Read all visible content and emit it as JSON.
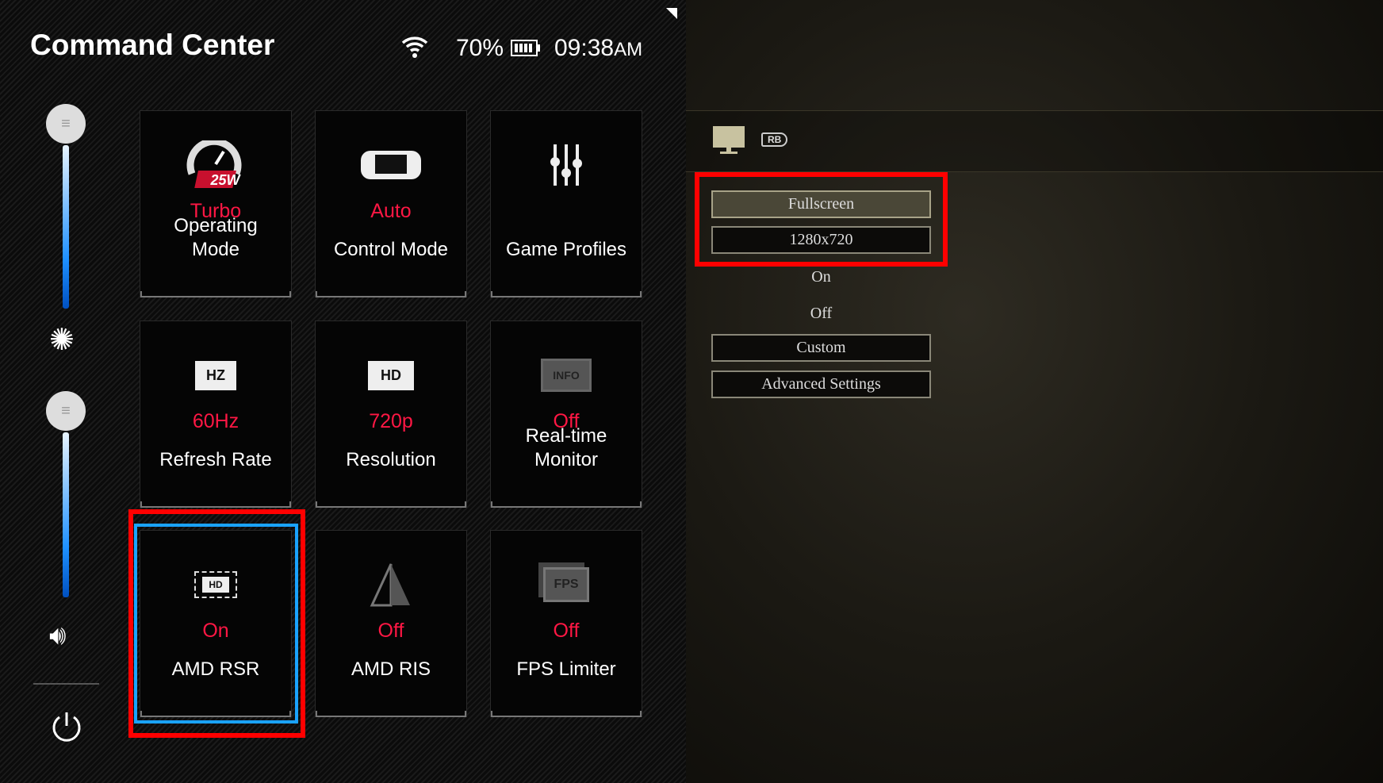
{
  "header": {
    "title": "Command Center",
    "battery_percent": "70%",
    "time": "09:38",
    "time_suffix": "AM"
  },
  "sliders": [
    {
      "name": "brightness",
      "level": 1.0
    },
    {
      "name": "volume",
      "level": 1.0
    }
  ],
  "tiles": [
    {
      "value": "Turbo",
      "label": "Operating Mode",
      "badge": "25W",
      "icon": "speedometer-icon"
    },
    {
      "value": "Auto",
      "label": "Control Mode",
      "icon": "handheld-console-icon"
    },
    {
      "value": "",
      "label": "Game Profiles",
      "icon": "equalizer-icon"
    },
    {
      "value": "60Hz",
      "label": "Refresh Rate",
      "icon": "refresh-rate-icon",
      "icon_text": "HZ"
    },
    {
      "value": "720p",
      "label": "Resolution",
      "icon": "resolution-icon",
      "icon_text": "HD"
    },
    {
      "value": "Off",
      "label": "Real-time Monitor",
      "icon": "monitor-info-icon",
      "icon_text": "INFO"
    },
    {
      "value": "On",
      "label": "AMD RSR",
      "icon": "rsr-icon",
      "icon_text": "HD"
    },
    {
      "value": "Off",
      "label": "AMD RIS",
      "icon": "sharpen-icon"
    },
    {
      "value": "Off",
      "label": "FPS Limiter",
      "icon": "fps-icon",
      "icon_text": "FPS"
    }
  ],
  "game_settings": {
    "tab_hint": "RB",
    "items": [
      "Fullscreen",
      "1280x720",
      "On",
      "Off",
      "Custom",
      "Advanced Settings"
    ]
  },
  "colors": {
    "accent_red": "#ff1744",
    "highlight_blue": "#1aa3ff",
    "annotation_red": "#ff0000"
  }
}
